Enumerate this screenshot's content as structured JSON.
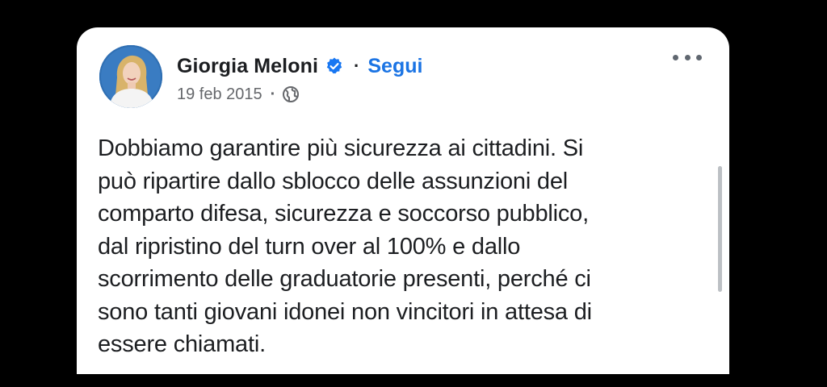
{
  "post": {
    "author": "Giorgia Meloni",
    "verified_icon": "verified-badge-icon",
    "follow_label": "Segui",
    "separator": "·",
    "date": "19 feb 2015",
    "audience_icon": "globe-icon",
    "more_icon": "more-options-icon",
    "text": "Dobbiamo garantire più sicurezza ai cittadini. Si\npuò ripartire dallo sblocco delle assunzioni del\ncomparto difesa, sicurezza e soccorso pubblico,\ndal ripristino del turn over al 100% e dallo\nscorrimento delle graduatorie presenti, perché ci\nsono tanti giovani idonei non vincitori in attesa di\nessere chiamati."
  },
  "colors": {
    "background": "#000000",
    "card": "#ffffff",
    "text": "#1c1e21",
    "secondary_text": "#65676b",
    "link": "#1b74e4",
    "verified": "#1877f2"
  }
}
